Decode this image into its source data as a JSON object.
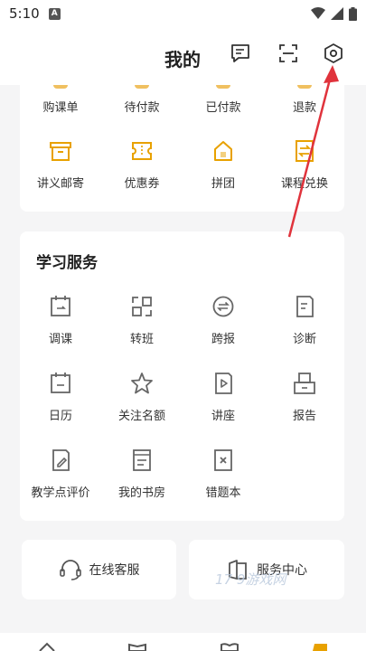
{
  "status": {
    "time": "5:10",
    "app_badge": "A"
  },
  "header": {
    "title": "我的"
  },
  "orders": {
    "row1": [
      "购课单",
      "待付款",
      "已付款",
      "退款"
    ],
    "row2": [
      "讲义邮寄",
      "优惠券",
      "拼团",
      "课程兑换"
    ]
  },
  "study": {
    "title": "学习服务",
    "items": [
      "调课",
      "转班",
      "跨报",
      "诊断",
      "日历",
      "关注名额",
      "讲座",
      "报告",
      "教学点评价",
      "我的书房",
      "错题本"
    ]
  },
  "support": {
    "online_service": "在线客服",
    "service_center": "服务中心"
  },
  "watermark": "17 9游戏网",
  "colors": {
    "accent": "#e8a100",
    "icon_gray": "#6b6b6b",
    "arrow": "#e0333c"
  }
}
